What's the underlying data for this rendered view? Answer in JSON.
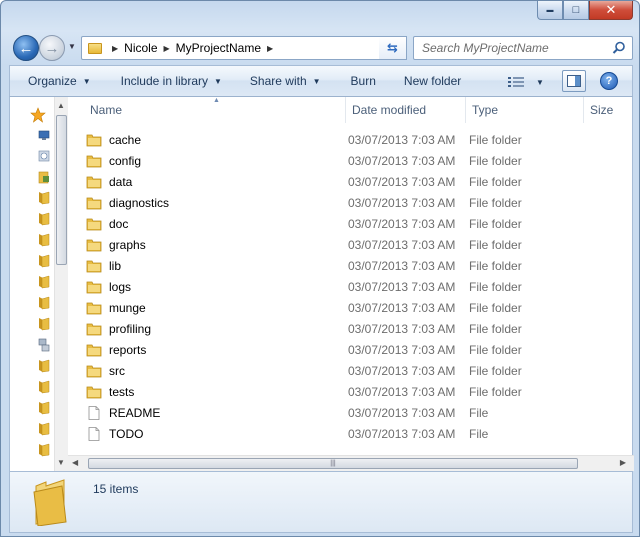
{
  "window": {
    "caption_buttons": {
      "minimize": "▬",
      "maximize": "□",
      "close": "✕"
    }
  },
  "address": {
    "crumbs": [
      "Nicole",
      "MyProjectName"
    ],
    "search_placeholder": "Search MyProjectName"
  },
  "toolbar": {
    "organize": "Organize",
    "include_in_library": "Include in library",
    "share_with": "Share with",
    "burn": "Burn",
    "new_folder": "New folder",
    "help": "?"
  },
  "columns": {
    "name": "Name",
    "date_modified": "Date modified",
    "type": "Type",
    "size": "Size"
  },
  "files": [
    {
      "name": "cache",
      "date": "03/07/2013 7:03 AM",
      "type": "File folder",
      "kind": "folder"
    },
    {
      "name": "config",
      "date": "03/07/2013 7:03 AM",
      "type": "File folder",
      "kind": "folder"
    },
    {
      "name": "data",
      "date": "03/07/2013 7:03 AM",
      "type": "File folder",
      "kind": "folder"
    },
    {
      "name": "diagnostics",
      "date": "03/07/2013 7:03 AM",
      "type": "File folder",
      "kind": "folder"
    },
    {
      "name": "doc",
      "date": "03/07/2013 7:03 AM",
      "type": "File folder",
      "kind": "folder"
    },
    {
      "name": "graphs",
      "date": "03/07/2013 7:03 AM",
      "type": "File folder",
      "kind": "folder"
    },
    {
      "name": "lib",
      "date": "03/07/2013 7:03 AM",
      "type": "File folder",
      "kind": "folder"
    },
    {
      "name": "logs",
      "date": "03/07/2013 7:03 AM",
      "type": "File folder",
      "kind": "folder"
    },
    {
      "name": "munge",
      "date": "03/07/2013 7:03 AM",
      "type": "File folder",
      "kind": "folder"
    },
    {
      "name": "profiling",
      "date": "03/07/2013 7:03 AM",
      "type": "File folder",
      "kind": "folder"
    },
    {
      "name": "reports",
      "date": "03/07/2013 7:03 AM",
      "type": "File folder",
      "kind": "folder"
    },
    {
      "name": "src",
      "date": "03/07/2013 7:03 AM",
      "type": "File folder",
      "kind": "folder"
    },
    {
      "name": "tests",
      "date": "03/07/2013 7:03 AM",
      "type": "File folder",
      "kind": "folder"
    },
    {
      "name": "README",
      "date": "03/07/2013 7:03 AM",
      "type": "File",
      "kind": "file"
    },
    {
      "name": "TODO",
      "date": "03/07/2013 7:03 AM",
      "type": "File",
      "kind": "file"
    }
  ],
  "nav_pane_icons": [
    "favorites-star",
    "desktop",
    "recent",
    "libraries",
    "folder",
    "folder",
    "folder",
    "folder",
    "folder",
    "folder",
    "folder",
    "network",
    "folder",
    "folder",
    "folder",
    "folder",
    "folder"
  ],
  "details": {
    "item_count": "15 items"
  },
  "colors": {
    "folder": "#e8bd42",
    "accent": "#1e395b",
    "secondary_text": "#6d6d6d"
  }
}
